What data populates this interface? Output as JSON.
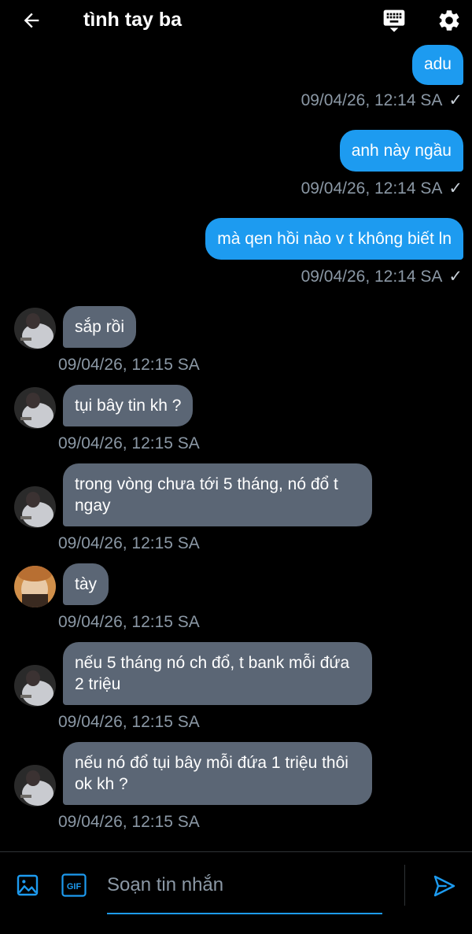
{
  "header": {
    "title": "tình tay ba",
    "back_icon": "arrow-left-icon",
    "keyboard_icon": "keyboard-icon",
    "settings_icon": "gear-icon"
  },
  "messages": [
    {
      "type": "out",
      "text": "adu",
      "time": "09/04/26, 12:14 SA",
      "status": "✓"
    },
    {
      "type": "out",
      "text": "anh này ngầu",
      "time": "09/04/26, 12:14 SA",
      "status": "✓"
    },
    {
      "type": "out",
      "text": "mà qen hồi nào v t không biết ln",
      "time": "09/04/26, 12:14 SA",
      "status": "✓"
    },
    {
      "type": "in",
      "text": "sắp rồi",
      "time": "09/04/26, 12:15 SA"
    },
    {
      "type": "in",
      "text": "tụi bây tin kh ?",
      "time": "09/04/26, 12:15 SA"
    },
    {
      "type": "in",
      "text": "trong vòng chưa tới 5 tháng, nó đổ t ngay",
      "time": "09/04/26, 12:15 SA"
    },
    {
      "type": "in",
      "text": "tày",
      "time": "09/04/26, 12:15 SA"
    },
    {
      "type": "in",
      "text": "nếu 5 tháng nó ch đổ, t bank mỗi đứa 2 triệu",
      "time": "09/04/26, 12:15 SA"
    },
    {
      "type": "in",
      "text": "nếu nó đổ tụi bây mỗi đứa 1 triệu thôi ok kh ?",
      "time": "09/04/26, 12:15 SA"
    }
  ],
  "composer": {
    "placeholder": "Soạn tin nhắn",
    "image_icon": "image-icon",
    "gif_label": "GIF",
    "send_icon": "send-icon"
  },
  "colors": {
    "background": "#000000",
    "outgoing_bubble": "#1d9bf0",
    "incoming_bubble": "#5b6675",
    "timestamp": "#8b98a5",
    "accent": "#1d9bf0"
  }
}
